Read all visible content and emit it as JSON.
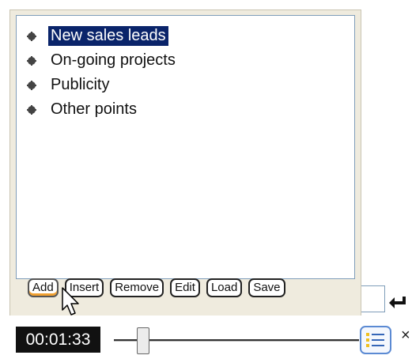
{
  "playlist": {
    "items": [
      {
        "label": "New sales leads",
        "selected": true
      },
      {
        "label": "On-going projects",
        "selected": false
      },
      {
        "label": "Publicity",
        "selected": false
      },
      {
        "label": "Other points",
        "selected": false
      }
    ]
  },
  "toolbar": {
    "add_label": "Add",
    "insert_label": "Insert",
    "remove_label": "Remove",
    "edit_label": "Edit",
    "load_label": "Load",
    "save_label": "Save"
  },
  "player": {
    "time": "00:01:33",
    "slider_position": 0.12,
    "close_glyph": "×"
  },
  "icons": {
    "bullet": "bullet-icon",
    "enter": "enter-icon",
    "cursor": "mouse-cursor-icon",
    "list_view": "list-view-icon",
    "close": "close-icon"
  },
  "colors": {
    "selection_bg": "#0a246a",
    "selection_fg": "#ffffff",
    "panel_bg": "#efebde",
    "time_bg": "#111111",
    "accent_blue": "#5b8ad3",
    "bullet_accent": "#f0c020"
  }
}
